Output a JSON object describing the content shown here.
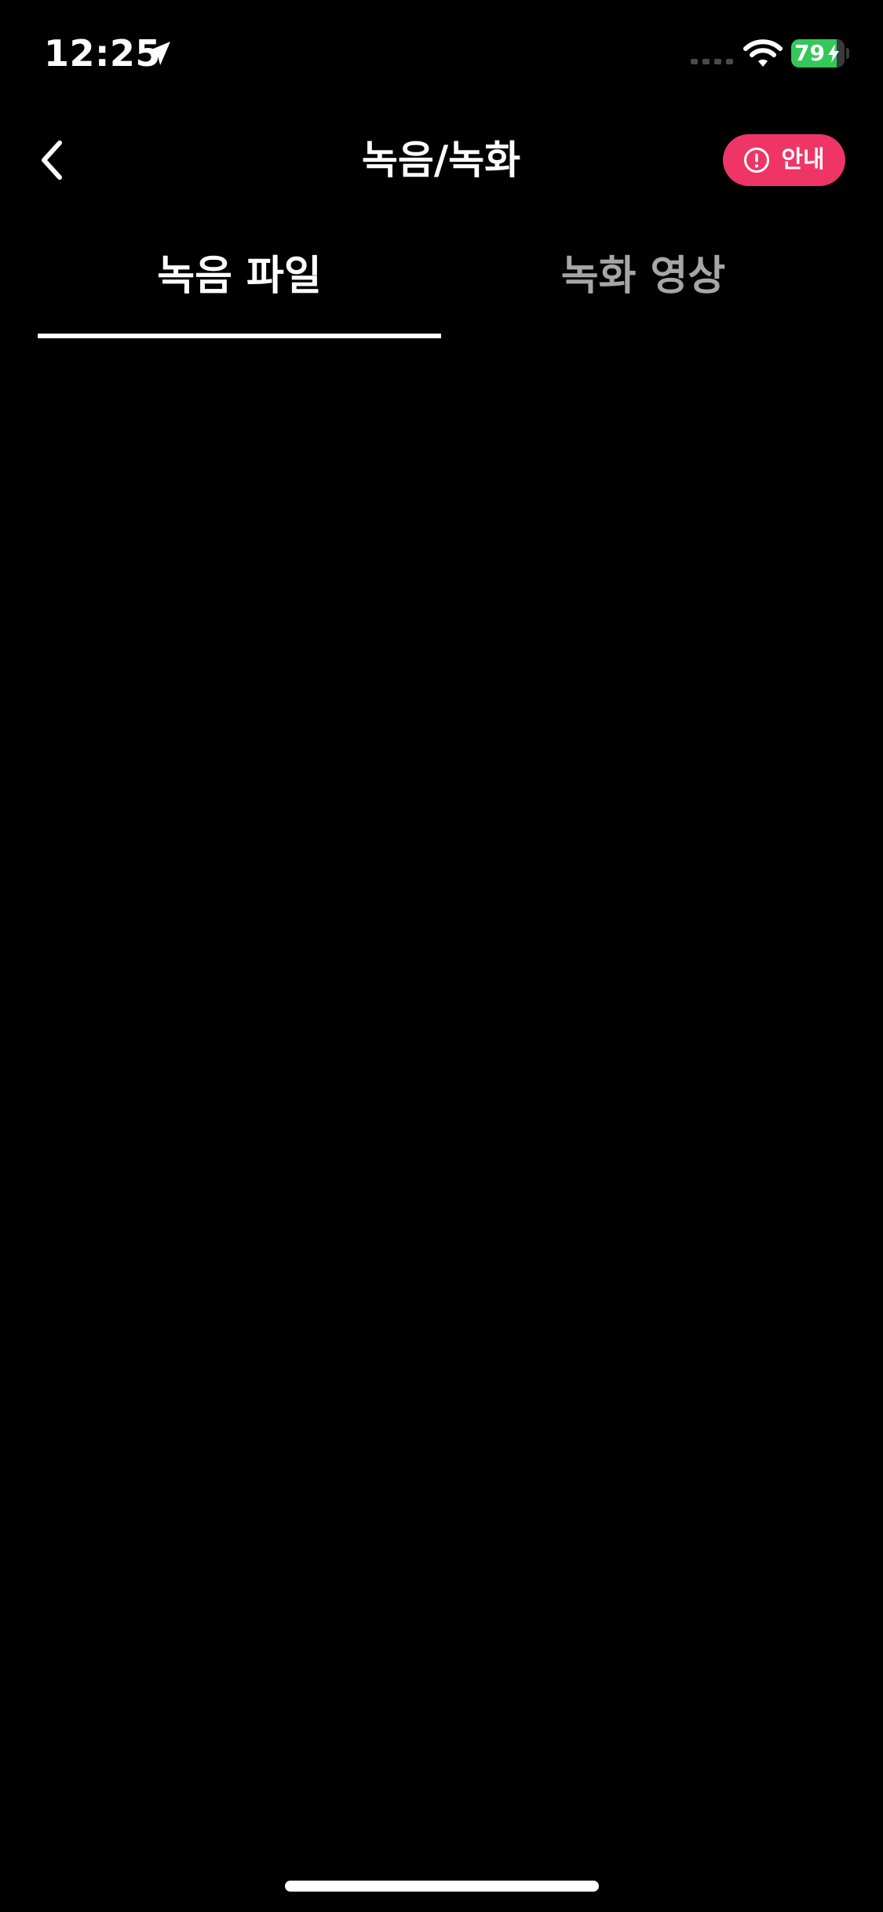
{
  "status_bar": {
    "time": "12:25",
    "battery_level": "79",
    "location_icon": "location-arrow-icon",
    "signal_icon": "cellular-signal-icon",
    "wifi_icon": "wifi-icon",
    "battery_icon": "battery-charging-icon",
    "battery_color": "#34c759"
  },
  "header": {
    "title": "녹음/녹화",
    "back_icon": "chevron-left-icon",
    "info_button": {
      "label": "안내",
      "icon": "exclamation-circle-icon",
      "color": "#ee3566"
    }
  },
  "tabs": [
    {
      "label": "녹음 파일",
      "selected": true
    },
    {
      "label": "녹화 영상",
      "selected": false
    }
  ],
  "colors": {
    "background": "#000000",
    "tab_inactive": "#a6a6a6"
  }
}
